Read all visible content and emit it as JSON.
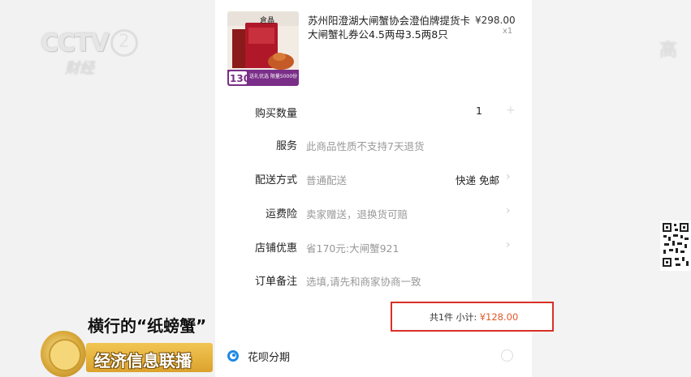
{
  "broadcast": {
    "channel_logo": "CCTV",
    "channel_number": "2",
    "channel_sub": "财经",
    "hd_mark": "高",
    "tagline": "横行的“纸螃蟹”",
    "program": "经济信息联播"
  },
  "product": {
    "title": "苏州阳澄湖大闸蟹协会澄伯牌提货卡大闸蟹礼券公4.5两母3.5两8只",
    "price": "¥298.00",
    "quantity": "x1",
    "image_badge": "130",
    "image_caption": "送礼优选 限量5000份",
    "image_label": "倉晶"
  },
  "order": {
    "qty": {
      "label": "购买数量",
      "value": "1"
    },
    "service": {
      "label": "服务",
      "value": "此商品性质不支持7天退货"
    },
    "delivery": {
      "label": "配送方式",
      "value": "普通配送",
      "right": "快递 免邮"
    },
    "shipping_insurance": {
      "label": "运费险",
      "value": "卖家赠送，退换货可赔"
    },
    "shop_discount": {
      "label": "店铺优惠",
      "value": "省170元:大闸蟹921"
    },
    "note": {
      "label": "订单备注",
      "value": "选填,请先和商家协商一致"
    }
  },
  "subtotal": {
    "count": "共1件",
    "label": "小计:",
    "amount": "¥128.00"
  },
  "payment": {
    "huabei_label": "花呗分期"
  },
  "colors": {
    "highlight_border": "#d93025",
    "price_accent": "#e0582b",
    "huabei_blue": "#1e88e5"
  }
}
